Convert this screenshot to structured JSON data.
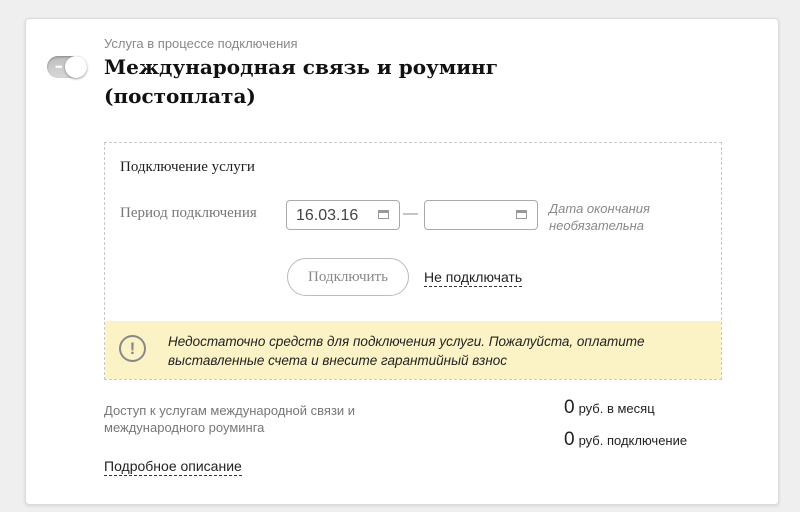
{
  "service": {
    "status": "Услуга в процессе подключения",
    "title": "Международная связь и роуминг (постоплата)",
    "toggle_on": false
  },
  "connect": {
    "heading": "Подключение услуги",
    "period_label": "Период подключения",
    "start_date": "16.03.16",
    "end_date": "",
    "separator": "—",
    "end_hint": "Дата окончания необязательна",
    "connect_button": "Подключить",
    "cancel_link": "Не подключать"
  },
  "warning": {
    "icon": "exclamation-circle-icon",
    "text": "Недостаточно средств для подключения услуги. Пожалуйста, оплатите выставленные счета и внесите гарантийный взнос"
  },
  "details": {
    "description": "Доступ к услугам международной связи и международного роуминга",
    "monthly_amount": "0",
    "monthly_label": "руб. в месяц",
    "connection_amount": "0",
    "connection_label": "руб. подключение",
    "more_link": "Подробное описание"
  }
}
